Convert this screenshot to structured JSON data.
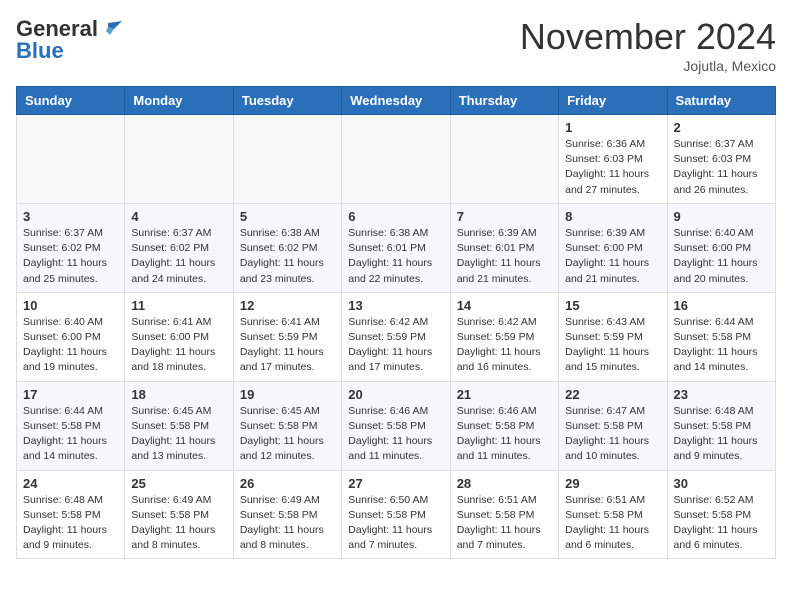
{
  "header": {
    "logo_general": "General",
    "logo_blue": "Blue",
    "month": "November 2024",
    "location": "Jojutla, Mexico"
  },
  "weekdays": [
    "Sunday",
    "Monday",
    "Tuesday",
    "Wednesday",
    "Thursday",
    "Friday",
    "Saturday"
  ],
  "weeks": [
    [
      {
        "day": "",
        "info": ""
      },
      {
        "day": "",
        "info": ""
      },
      {
        "day": "",
        "info": ""
      },
      {
        "day": "",
        "info": ""
      },
      {
        "day": "",
        "info": ""
      },
      {
        "day": "1",
        "info": "Sunrise: 6:36 AM\nSunset: 6:03 PM\nDaylight: 11 hours and 27 minutes."
      },
      {
        "day": "2",
        "info": "Sunrise: 6:37 AM\nSunset: 6:03 PM\nDaylight: 11 hours and 26 minutes."
      }
    ],
    [
      {
        "day": "3",
        "info": "Sunrise: 6:37 AM\nSunset: 6:02 PM\nDaylight: 11 hours and 25 minutes."
      },
      {
        "day": "4",
        "info": "Sunrise: 6:37 AM\nSunset: 6:02 PM\nDaylight: 11 hours and 24 minutes."
      },
      {
        "day": "5",
        "info": "Sunrise: 6:38 AM\nSunset: 6:02 PM\nDaylight: 11 hours and 23 minutes."
      },
      {
        "day": "6",
        "info": "Sunrise: 6:38 AM\nSunset: 6:01 PM\nDaylight: 11 hours and 22 minutes."
      },
      {
        "day": "7",
        "info": "Sunrise: 6:39 AM\nSunset: 6:01 PM\nDaylight: 11 hours and 21 minutes."
      },
      {
        "day": "8",
        "info": "Sunrise: 6:39 AM\nSunset: 6:00 PM\nDaylight: 11 hours and 21 minutes."
      },
      {
        "day": "9",
        "info": "Sunrise: 6:40 AM\nSunset: 6:00 PM\nDaylight: 11 hours and 20 minutes."
      }
    ],
    [
      {
        "day": "10",
        "info": "Sunrise: 6:40 AM\nSunset: 6:00 PM\nDaylight: 11 hours and 19 minutes."
      },
      {
        "day": "11",
        "info": "Sunrise: 6:41 AM\nSunset: 6:00 PM\nDaylight: 11 hours and 18 minutes."
      },
      {
        "day": "12",
        "info": "Sunrise: 6:41 AM\nSunset: 5:59 PM\nDaylight: 11 hours and 17 minutes."
      },
      {
        "day": "13",
        "info": "Sunrise: 6:42 AM\nSunset: 5:59 PM\nDaylight: 11 hours and 17 minutes."
      },
      {
        "day": "14",
        "info": "Sunrise: 6:42 AM\nSunset: 5:59 PM\nDaylight: 11 hours and 16 minutes."
      },
      {
        "day": "15",
        "info": "Sunrise: 6:43 AM\nSunset: 5:59 PM\nDaylight: 11 hours and 15 minutes."
      },
      {
        "day": "16",
        "info": "Sunrise: 6:44 AM\nSunset: 5:58 PM\nDaylight: 11 hours and 14 minutes."
      }
    ],
    [
      {
        "day": "17",
        "info": "Sunrise: 6:44 AM\nSunset: 5:58 PM\nDaylight: 11 hours and 14 minutes."
      },
      {
        "day": "18",
        "info": "Sunrise: 6:45 AM\nSunset: 5:58 PM\nDaylight: 11 hours and 13 minutes."
      },
      {
        "day": "19",
        "info": "Sunrise: 6:45 AM\nSunset: 5:58 PM\nDaylight: 11 hours and 12 minutes."
      },
      {
        "day": "20",
        "info": "Sunrise: 6:46 AM\nSunset: 5:58 PM\nDaylight: 11 hours and 11 minutes."
      },
      {
        "day": "21",
        "info": "Sunrise: 6:46 AM\nSunset: 5:58 PM\nDaylight: 11 hours and 11 minutes."
      },
      {
        "day": "22",
        "info": "Sunrise: 6:47 AM\nSunset: 5:58 PM\nDaylight: 11 hours and 10 minutes."
      },
      {
        "day": "23",
        "info": "Sunrise: 6:48 AM\nSunset: 5:58 PM\nDaylight: 11 hours and 9 minutes."
      }
    ],
    [
      {
        "day": "24",
        "info": "Sunrise: 6:48 AM\nSunset: 5:58 PM\nDaylight: 11 hours and 9 minutes."
      },
      {
        "day": "25",
        "info": "Sunrise: 6:49 AM\nSunset: 5:58 PM\nDaylight: 11 hours and 8 minutes."
      },
      {
        "day": "26",
        "info": "Sunrise: 6:49 AM\nSunset: 5:58 PM\nDaylight: 11 hours and 8 minutes."
      },
      {
        "day": "27",
        "info": "Sunrise: 6:50 AM\nSunset: 5:58 PM\nDaylight: 11 hours and 7 minutes."
      },
      {
        "day": "28",
        "info": "Sunrise: 6:51 AM\nSunset: 5:58 PM\nDaylight: 11 hours and 7 minutes."
      },
      {
        "day": "29",
        "info": "Sunrise: 6:51 AM\nSunset: 5:58 PM\nDaylight: 11 hours and 6 minutes."
      },
      {
        "day": "30",
        "info": "Sunrise: 6:52 AM\nSunset: 5:58 PM\nDaylight: 11 hours and 6 minutes."
      }
    ]
  ]
}
